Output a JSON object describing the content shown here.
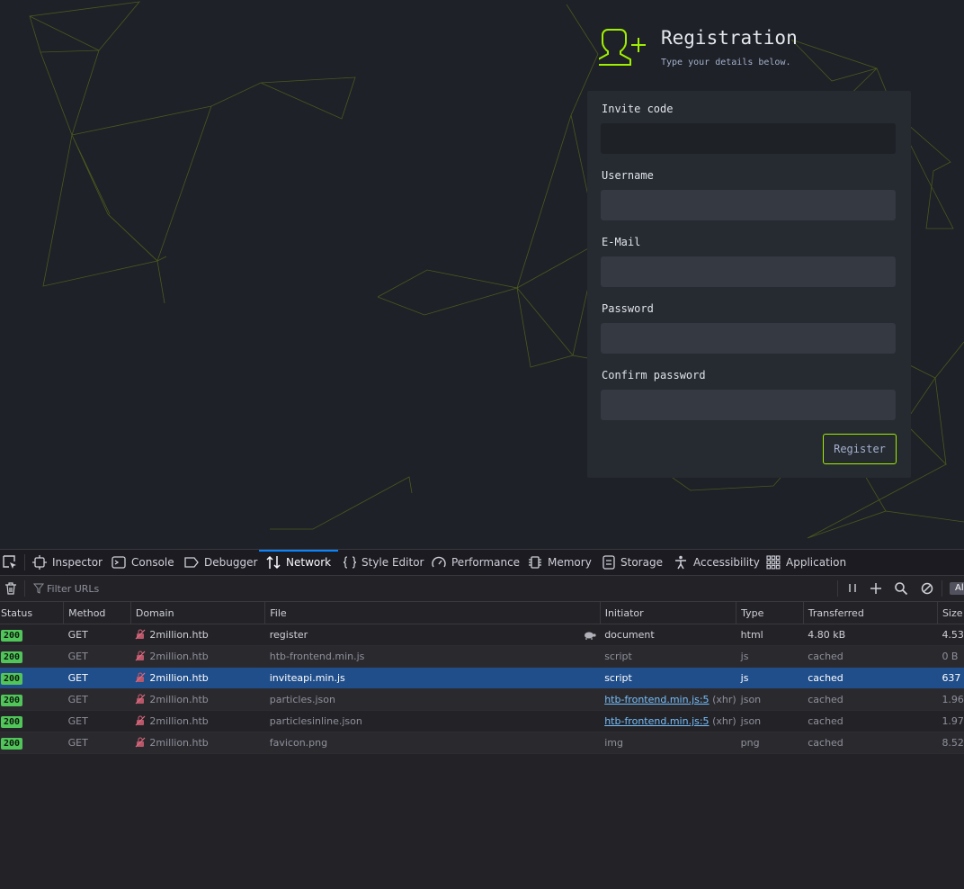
{
  "registration": {
    "title": "Registration",
    "subtitle": "Type your details below.",
    "fields": {
      "invite_code": {
        "label": "Invite code",
        "value": ""
      },
      "username": {
        "label": "Username",
        "value": ""
      },
      "email": {
        "label": "E-Mail",
        "value": ""
      },
      "password": {
        "label": "Password",
        "value": ""
      },
      "confirm_password": {
        "label": "Confirm password",
        "value": ""
      }
    },
    "register_label": "Register",
    "accent_color": "#9fef00"
  },
  "devtools": {
    "tabs": [
      {
        "label": "Inspector",
        "icon": "inspector-icon"
      },
      {
        "label": "Console",
        "icon": "console-icon"
      },
      {
        "label": "Debugger",
        "icon": "debugger-icon"
      },
      {
        "label": "Network",
        "icon": "network-icon",
        "active": true
      },
      {
        "label": "Style Editor",
        "icon": "style-editor-icon"
      },
      {
        "label": "Performance",
        "icon": "performance-icon"
      },
      {
        "label": "Memory",
        "icon": "memory-icon"
      },
      {
        "label": "Storage",
        "icon": "storage-icon"
      },
      {
        "label": "Accessibility",
        "icon": "accessibility-icon"
      },
      {
        "label": "Application",
        "icon": "application-icon"
      }
    ],
    "filter_placeholder": "Filter URLs",
    "all_badge": "Al",
    "columns": {
      "status": "Status",
      "method": "Method",
      "domain": "Domain",
      "file": "File",
      "initiator": "Initiator",
      "type": "Type",
      "transferred": "Transferred",
      "size": "Size"
    },
    "requests": [
      {
        "status": "200",
        "method": "GET",
        "domain": "2million.htb",
        "file": "register",
        "initiator": "document",
        "initiator_link": false,
        "initiator_suffix": "",
        "type": "html",
        "transferred": "4.80 kB",
        "size": "4.53"
      },
      {
        "status": "200",
        "method": "GET",
        "domain": "2million.htb",
        "file": "htb-frontend.min.js",
        "initiator": "script",
        "initiator_link": false,
        "initiator_suffix": "",
        "type": "js",
        "transferred": "cached",
        "size": "0 B"
      },
      {
        "status": "200",
        "method": "GET",
        "domain": "2million.htb",
        "file": "inviteapi.min.js",
        "initiator": "script",
        "initiator_link": false,
        "initiator_suffix": "",
        "type": "js",
        "transferred": "cached",
        "size": "637"
      },
      {
        "status": "200",
        "method": "GET",
        "domain": "2million.htb",
        "file": "particles.json",
        "initiator": "htb-frontend.min.js:5",
        "initiator_link": true,
        "initiator_suffix": "(xhr)",
        "type": "json",
        "transferred": "cached",
        "size": "1.96"
      },
      {
        "status": "200",
        "method": "GET",
        "domain": "2million.htb",
        "file": "particlesinline.json",
        "initiator": "htb-frontend.min.js:5",
        "initiator_link": true,
        "initiator_suffix": "(xhr)",
        "type": "json",
        "transferred": "cached",
        "size": "1.97"
      },
      {
        "status": "200",
        "method": "GET",
        "domain": "2million.htb",
        "file": "favicon.png",
        "initiator": "img",
        "initiator_link": false,
        "initiator_suffix": "",
        "type": "png",
        "transferred": "cached",
        "size": "8.52"
      }
    ]
  }
}
